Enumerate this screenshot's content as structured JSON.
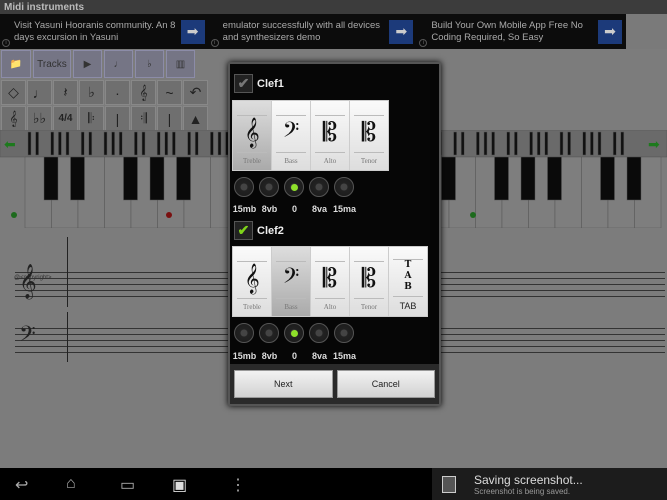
{
  "title": "Midi instruments",
  "ads": [
    {
      "text": "Visit Yasuni Hooranis community. An 8 days excursion in Yasuni"
    },
    {
      "text": "emulator successfully with all devices and synthesizers demo"
    },
    {
      "text": "Build Your Own Mobile App Free No Coding Required, So Easy"
    }
  ],
  "toolbar": {
    "tracks_label": "Tracks"
  },
  "score": {
    "copyright": "@<copyright>"
  },
  "dialog": {
    "clef1": {
      "label": "Clef1",
      "checked": false,
      "selected": "Treble",
      "octave": "0"
    },
    "clef2": {
      "label": "Clef2",
      "checked": true,
      "selected": "Bass",
      "octave": "0"
    },
    "clefs": [
      "Treble",
      "Bass",
      "Alto",
      "Tenor"
    ],
    "tab_label": "TAB",
    "octaves": [
      "15mb",
      "8vb",
      "0",
      "8va",
      "15ma"
    ],
    "next_label": "Next",
    "cancel_label": "Cancel"
  },
  "notification": {
    "title": "Saving screenshot...",
    "subtitle": "Screenshot is being saved."
  },
  "colors": {
    "accent": "#8ee02a",
    "ad_button": "#1c3a7a"
  }
}
